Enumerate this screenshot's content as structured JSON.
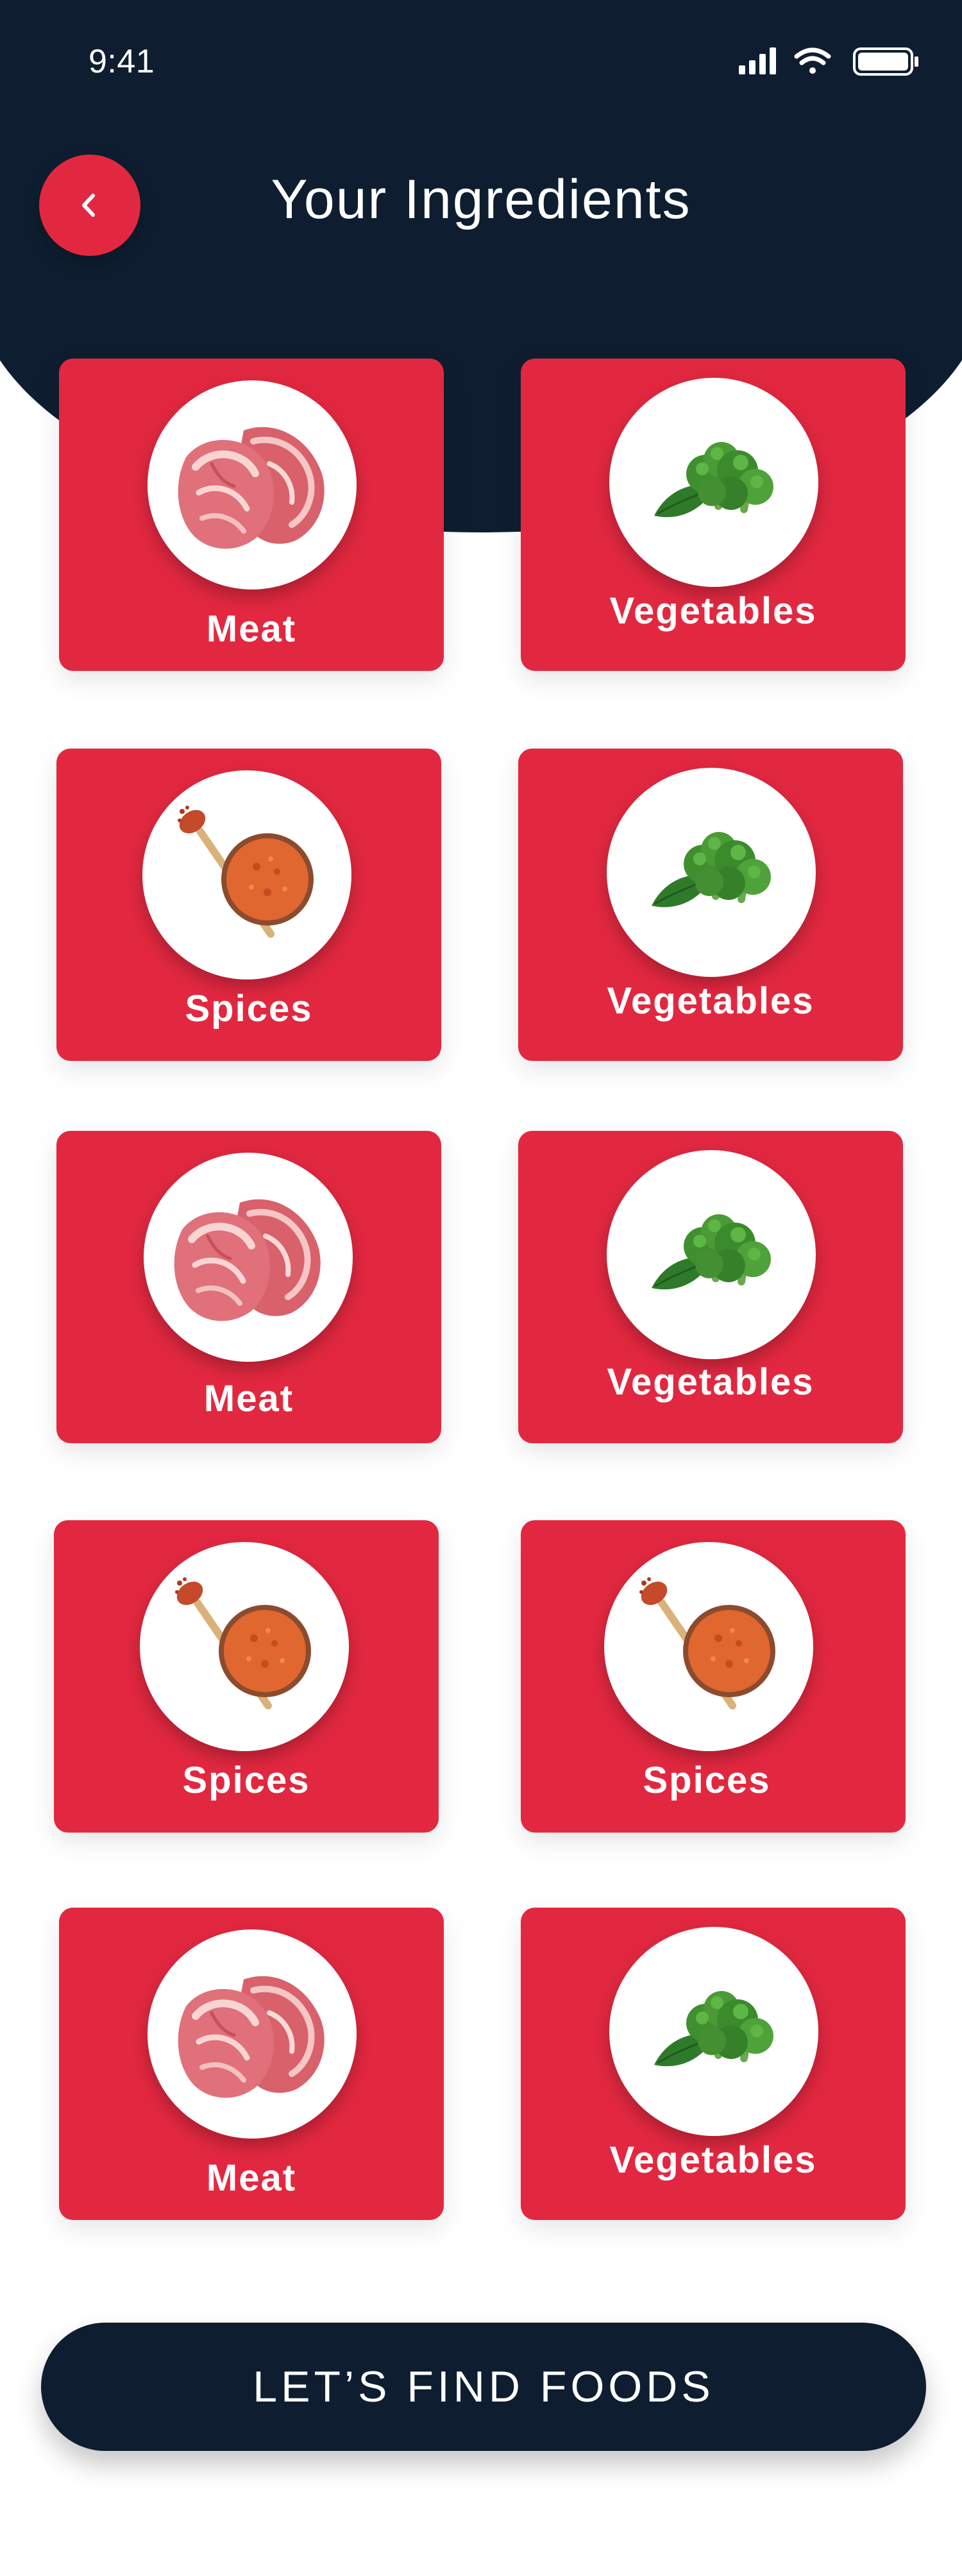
{
  "status_bar": {
    "time": "9:41",
    "icons": [
      "signal-icon",
      "wifi-icon",
      "battery-icon"
    ]
  },
  "header": {
    "title": "Your Ingredients",
    "back_icon": "chevron-left-icon"
  },
  "ingredients": [
    {
      "label": "Meat",
      "icon": "meat-icon"
    },
    {
      "label": "Vegetables",
      "icon": "broccoli-icon"
    },
    {
      "label": "Spices",
      "icon": "spice-bowl-icon"
    },
    {
      "label": "Vegetables",
      "icon": "broccoli-icon"
    },
    {
      "label": "Meat",
      "icon": "meat-icon"
    },
    {
      "label": "Vegetables",
      "icon": "broccoli-icon"
    },
    {
      "label": "Spices",
      "icon": "spice-bowl-icon"
    },
    {
      "label": "Spices",
      "icon": "spice-bowl-icon"
    },
    {
      "label": "Meat",
      "icon": "meat-icon"
    },
    {
      "label": "Vegetables",
      "icon": "broccoli-icon"
    }
  ],
  "cta": {
    "label": "LET’S FIND FOODS"
  },
  "colors": {
    "header_bg": "#0e1e30",
    "accent": "#e22840",
    "text_on_dark": "#ffffff"
  }
}
